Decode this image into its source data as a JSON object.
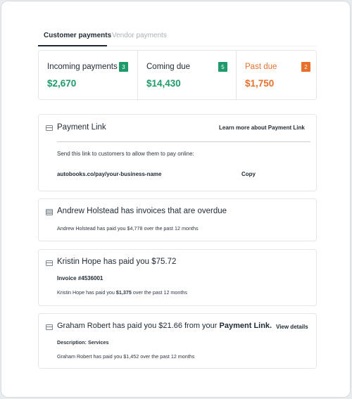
{
  "tabs": [
    {
      "label": "Customer payments",
      "active": true
    },
    {
      "label": "Vendor payments",
      "active": false
    }
  ],
  "summary": [
    {
      "label": "Incoming payments",
      "count": "3",
      "value": "$2,670",
      "color": "#1f9a6a"
    },
    {
      "label": "Coming due",
      "count": "5",
      "value": "$14,430",
      "color": "#1f9a6a"
    },
    {
      "label": "Past due",
      "count": "2",
      "value": "$1,750",
      "color": "#e8702a"
    }
  ],
  "payment_link": {
    "icon": "credit-card-icon",
    "title": "Payment Link",
    "learn_more": "Learn more about Payment Link",
    "description": "Send this link to customers to allow them to pay online:",
    "url": "autobooks.co/pay/your-business-name",
    "copy_label": "Copy"
  },
  "activity": [
    {
      "icon": "invoice-list-icon",
      "title": "Andrew Holstead has invoices that are overdue",
      "detail": "Andrew Holstead has paid you $4,778 over the past 12 months"
    },
    {
      "icon": "credit-card-icon",
      "title": "Kristin Hope has paid you $75.72",
      "invoice": "Invoice #4536001",
      "detail_prefix": "Kristin Hope has paid you",
      "detail_amount": "$1,375",
      "detail_suffix": "over the past 12 months"
    },
    {
      "icon": "credit-card-icon",
      "title_prefix": "Graham Robert has paid you $21.66 from your",
      "title_link": "Payment Link.",
      "view_details": "View details",
      "description_label": "Description:",
      "description_value": "Services",
      "detail": "Graham Robert has paid you $1,452 over the past 12 months"
    }
  ],
  "colors": {
    "accent_green": "#1f9a6a",
    "accent_orange": "#e8702a",
    "text": "#1f2933"
  }
}
